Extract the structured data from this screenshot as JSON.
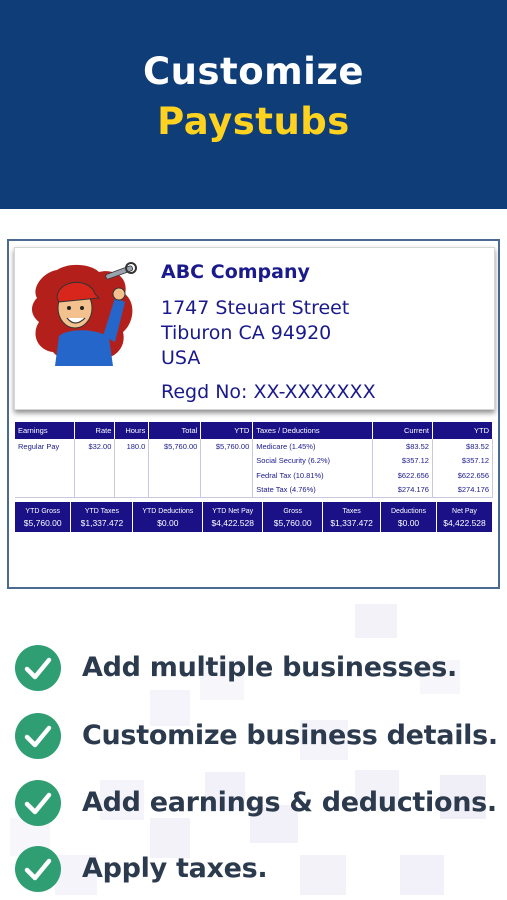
{
  "hero": {
    "line1": "Customize",
    "line2": "Paystubs",
    "bg_color": "#0f3d78",
    "highlight_color": "#ffd21f"
  },
  "company": {
    "logo_icon": "mechanic-with-wrench-icon",
    "name": "ABC Company",
    "address_line1": "1747 Steuart Street",
    "address_line2": "Tiburon CA 94920",
    "address_line3": "USA",
    "regd": "Regd No: XX-XXXXXXX"
  },
  "earnings": {
    "headers": [
      "Earnings",
      "Rate",
      "Hours",
      "Total",
      "YTD",
      "Taxes / Deductions",
      "Current",
      "YTD"
    ],
    "rows": [
      [
        "Regular Pay",
        "$32.00",
        "180.0",
        "$5,760.00",
        "$5,760.00",
        "Medicare (1.45%)",
        "$83.52",
        "$83.52"
      ],
      [
        "",
        "",
        "",
        "",
        "",
        "Social Security (6.2%)",
        "$357.12",
        "$357.12"
      ],
      [
        "",
        "",
        "",
        "",
        "",
        "Fedral Tax (10.81%)",
        "$622.656",
        "$622.656"
      ],
      [
        "",
        "",
        "",
        "",
        "",
        "State Tax (4.76%)",
        "$274.176",
        "$274.176"
      ]
    ]
  },
  "summary": {
    "labels": [
      "YTD Gross",
      "YTD Taxes",
      "YTD Deductions",
      "YTD Net Pay",
      "Gross",
      "Taxes",
      "Deductions",
      "Net Pay"
    ],
    "values": [
      "$5,760.00",
      "$1,337.472",
      "$0.00",
      "$4,422.528",
      "$5,760.00",
      "$1,337.472",
      "$0.00",
      "$4,422.528"
    ]
  },
  "features": [
    {
      "icon": "check-circle-icon",
      "text": "Add multiple businesses."
    },
    {
      "icon": "check-circle-icon",
      "text": "Customize business details."
    },
    {
      "icon": "check-circle-icon",
      "text": "Add earnings & deductions."
    },
    {
      "icon": "check-circle-icon",
      "text": "Apply taxes."
    }
  ],
  "colors": {
    "table_header": "#1a1187",
    "text_navy": "#1a1a8c",
    "check_green": "#2f9e73"
  }
}
